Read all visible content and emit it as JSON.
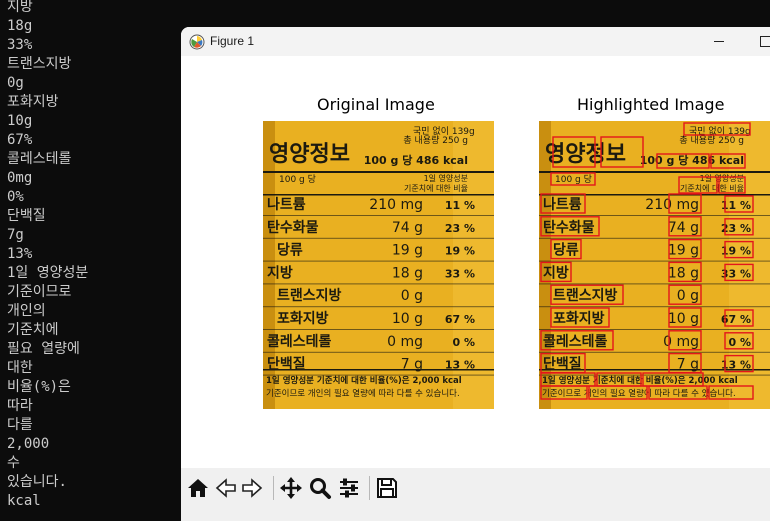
{
  "terminal": {
    "lines": [
      "지방",
      "18g",
      "33%",
      "트랜스지방",
      "0g",
      "포화지방",
      "10g",
      "67%",
      "콜레스테롤",
      "0mg",
      "0%",
      "단백질",
      "7g",
      "13%",
      "1일 영양성분",
      "기준이므로",
      "개인의",
      "기준치에",
      "필요 열량에",
      "대한",
      "비율(%)은",
      "따라",
      "다를",
      "2,000",
      "수",
      "있습니다.",
      "kcal"
    ]
  },
  "window": {
    "title": "Figure 1",
    "minimize_icon": "minimize-icon",
    "maximize_icon": "maximize-icon"
  },
  "figure": {
    "left_title": "Original Image",
    "right_title": "Highlighted Image"
  },
  "label": {
    "header": "영양정보",
    "package_note": "총 내용량 250 g",
    "per_100": "100 g 당 486 kcal",
    "per_small": "100 g 당",
    "ref_note_1": "1일 영양성분",
    "ref_note_2": "기준치에 대한 비율",
    "top_strip": "국민 없이 139g",
    "rows": [
      {
        "name": "나트륨",
        "amount": "210 mg",
        "pct": "11 %"
      },
      {
        "name": "탄수화물",
        "amount": "74 g",
        "pct": "23 %"
      },
      {
        "name": "당류",
        "amount": "19 g",
        "pct": "19 %"
      },
      {
        "name": "지방",
        "amount": "18 g",
        "pct": "33 %"
      },
      {
        "name": "트랜스지방",
        "amount": "0 g",
        "pct": ""
      },
      {
        "name": "포화지방",
        "amount": "10 g",
        "pct": "67 %"
      },
      {
        "name": "콜레스테롤",
        "amount": "0 mg",
        "pct": "0 %"
      },
      {
        "name": "단백질",
        "amount": "7 g",
        "pct": "13 %"
      }
    ],
    "footnote_1": "1일 영양성분 기준치에 대한 비율(%)은 2,000 kcal",
    "footnote_2": "기준이므로 개인의 필요 열량에 따라 다를 수 있습니다."
  },
  "toolbar": {
    "buttons": [
      {
        "name": "home-icon"
      },
      {
        "name": "back-arrow-icon"
      },
      {
        "name": "forward-arrow-icon"
      },
      {
        "name": "pan-icon"
      },
      {
        "name": "zoom-icon"
      },
      {
        "name": "configure-subplots-icon"
      },
      {
        "name": "save-icon"
      }
    ]
  },
  "colors": {
    "terminal_bg": "#0c0c0c",
    "terminal_text": "#cccccc",
    "label_yellow": "#e9b021",
    "label_text": "#1c1a10",
    "highlight_box": "#e3161b"
  }
}
